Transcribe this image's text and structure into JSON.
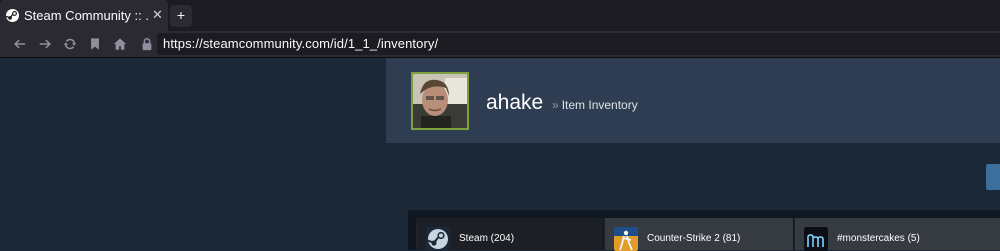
{
  "browser": {
    "tab": {
      "title": "Steam Community :: ...",
      "close_glyph": "✕"
    },
    "new_tab_glyph": "+",
    "url": "https://steamcommunity.com/id/1_1_/inventory/"
  },
  "profile": {
    "name": "ahake",
    "separator": "»",
    "breadcrumb": "Item Inventory"
  },
  "inventory": {
    "tabs": [
      {
        "label": "Steam (204)",
        "icon": "steam-logo-icon"
      },
      {
        "label": "Counter-Strike 2 (81)",
        "icon": "counter-strike-icon"
      },
      {
        "label": "#monstercakes (5)",
        "icon": "monstercakes-icon"
      }
    ]
  },
  "colors": {
    "page_bg": "#1b2838",
    "header_bg": "#2f3d52",
    "avatar_border": "#7da13c",
    "accent_button": "#3c6f9c"
  }
}
